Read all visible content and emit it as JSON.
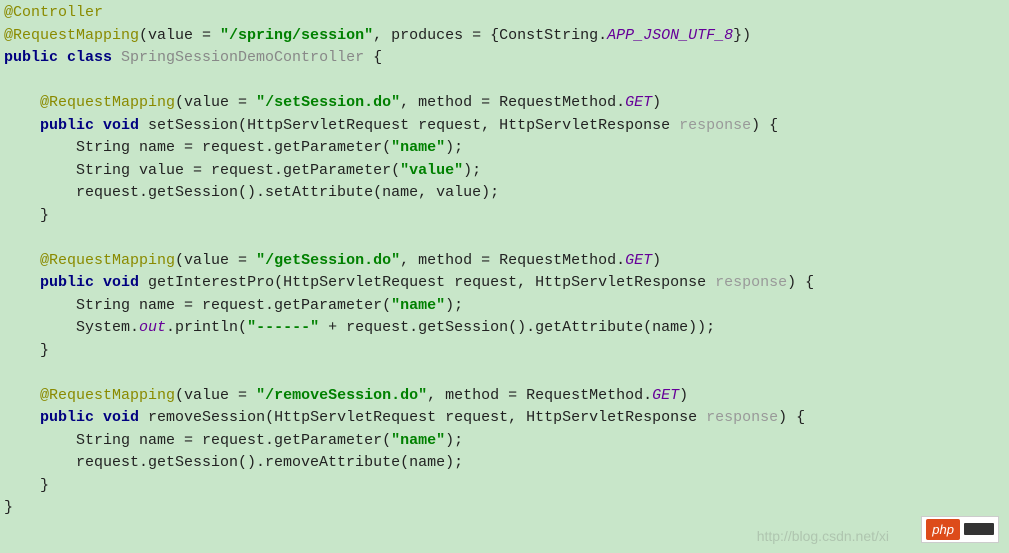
{
  "code": {
    "l1": {
      "a": "@Controller"
    },
    "l2": {
      "a": "@RequestMapping",
      "b": "(value = ",
      "s1": "\"/spring/session\"",
      "c": ", produces = {ConstString.",
      "sf": "APP_JSON_UTF_8",
      "d": "})"
    },
    "l3": {
      "kw1": "public class ",
      "cls": "SpringSessionDemoController",
      "b": " {"
    },
    "l4": "",
    "l5": {
      "pad": "    ",
      "a": "@RequestMapping",
      "b": "(value = ",
      "s1": "\"/setSession.do\"",
      "c": ", method = RequestMethod.",
      "sf": "GET",
      "d": ")"
    },
    "l6": {
      "pad": "    ",
      "kw": "public void ",
      "m": "setSession(HttpServletRequest request, HttpServletResponse ",
      "p": "response",
      "end": ") {"
    },
    "l7": {
      "pad": "        ",
      "t": "String name = request.getParameter(",
      "s": "\"name\"",
      "end": ");"
    },
    "l8": {
      "pad": "        ",
      "t": "String value = request.getParameter(",
      "s": "\"value\"",
      "end": ");"
    },
    "l9": {
      "pad": "        ",
      "t": "request.getSession().setAttribute(name, value);"
    },
    "l10": {
      "pad": "    ",
      "t": "}"
    },
    "l11": "",
    "l12": {
      "pad": "    ",
      "a": "@RequestMapping",
      "b": "(value = ",
      "s1": "\"/getSession.do\"",
      "c": ", method = RequestMethod.",
      "sf": "GET",
      "d": ")"
    },
    "l13": {
      "pad": "    ",
      "kw": "public void ",
      "m": "getInterestPro(HttpServletRequest request, HttpServletResponse ",
      "p": "response",
      "end": ") {"
    },
    "l14": {
      "pad": "        ",
      "t": "String name = request.getParameter(",
      "s": "\"name\"",
      "end": ");"
    },
    "l15": {
      "pad": "        ",
      "t1": "System.",
      "sf": "out",
      "t2": ".println(",
      "s": "\"------\"",
      "t3": " + request.getSession().getAttribute(name));"
    },
    "l16": {
      "pad": "    ",
      "t": "}"
    },
    "l17": "",
    "l18": {
      "pad": "    ",
      "a": "@RequestMapping",
      "b": "(value = ",
      "s1": "\"/removeSession.do\"",
      "c": ", method = RequestMethod.",
      "sf": "GET",
      "d": ")"
    },
    "l19": {
      "pad": "    ",
      "kw": "public void ",
      "m": "removeSession(HttpServletRequest request, HttpServletResponse ",
      "p": "response",
      "end": ") {"
    },
    "l20": {
      "pad": "        ",
      "t": "String name = request.getParameter(",
      "s": "\"name\"",
      "end": ");"
    },
    "l21": {
      "pad": "        ",
      "t": "request.getSession().removeAttribute(name);"
    },
    "l22": {
      "pad": "    ",
      "t": "}"
    },
    "l23": {
      "t": "}"
    }
  },
  "watermark": "http://blog.csdn.net/xi",
  "badge": "php"
}
